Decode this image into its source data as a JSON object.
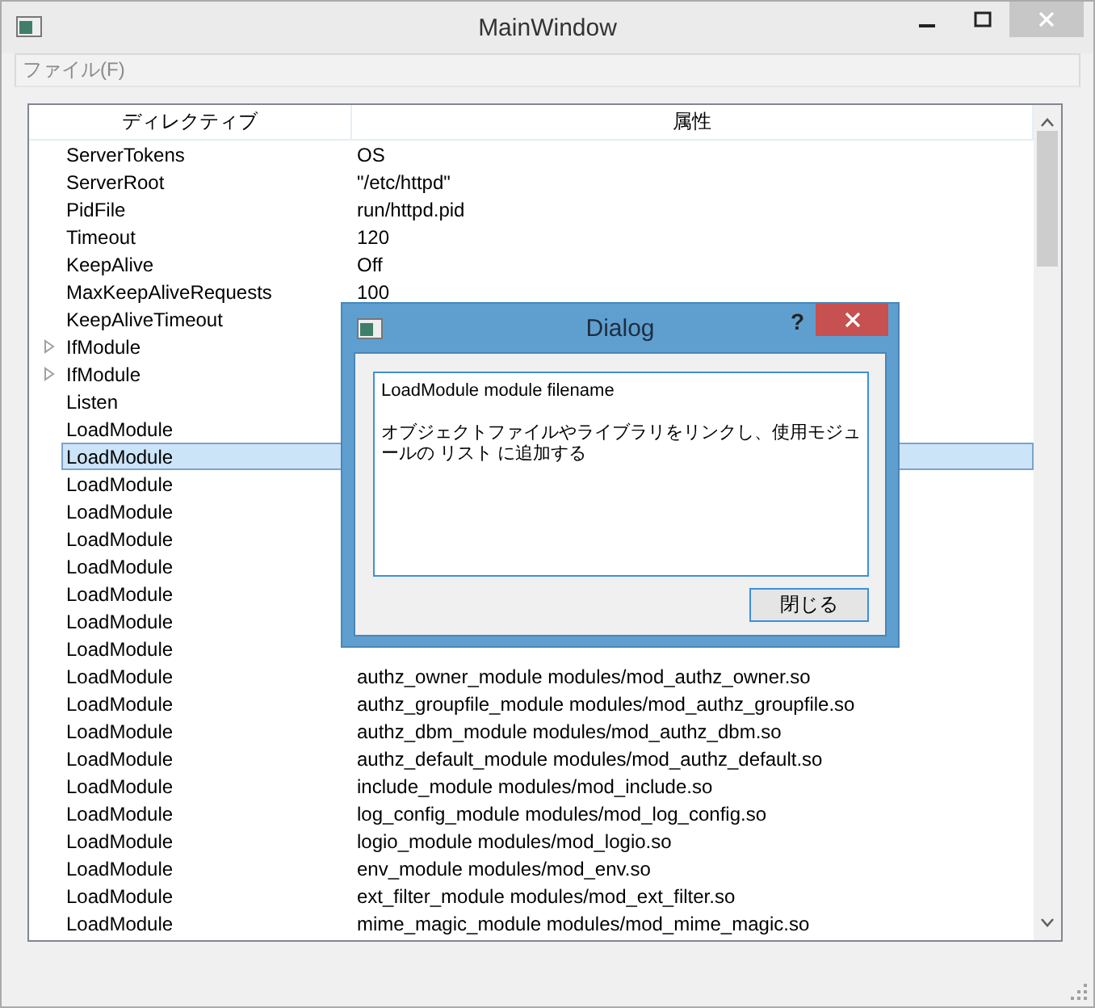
{
  "window": {
    "title": "MainWindow"
  },
  "menu": [
    {
      "label": "ファイル(F)"
    }
  ],
  "tree": {
    "columns": [
      "ディレクティブ",
      "属性"
    ],
    "rows": [
      {
        "key": "ServerTokens",
        "value": "OS",
        "expandable": false,
        "selected": false
      },
      {
        "key": "ServerRoot",
        "value": "\"/etc/httpd\"",
        "expandable": false,
        "selected": false
      },
      {
        "key": "PidFile",
        "value": "run/httpd.pid",
        "expandable": false,
        "selected": false
      },
      {
        "key": "Timeout",
        "value": "120",
        "expandable": false,
        "selected": false
      },
      {
        "key": "KeepAlive",
        "value": "Off",
        "expandable": false,
        "selected": false
      },
      {
        "key": "MaxKeepAliveRequests",
        "value": "100",
        "expandable": false,
        "selected": false
      },
      {
        "key": "KeepAliveTimeout",
        "expandable": false,
        "selected": false
      },
      {
        "key": "IfModule",
        "expandable": true,
        "selected": false
      },
      {
        "key": "IfModule",
        "expandable": true,
        "selected": false
      },
      {
        "key": "Listen",
        "expandable": false,
        "selected": false
      },
      {
        "key": "LoadModule",
        "expandable": false,
        "selected": false
      },
      {
        "key": "LoadModule",
        "expandable": false,
        "selected": true
      },
      {
        "key": "LoadModule",
        "expandable": false,
        "selected": false
      },
      {
        "key": "LoadModule",
        "expandable": false,
        "selected": false
      },
      {
        "key": "LoadModule",
        "expandable": false,
        "selected": false
      },
      {
        "key": "LoadModule",
        "expandable": false,
        "selected": false
      },
      {
        "key": "LoadModule",
        "expandable": false,
        "selected": false
      },
      {
        "key": "LoadModule",
        "expandable": false,
        "selected": false
      },
      {
        "key": "LoadModule",
        "expandable": false,
        "selected": false
      },
      {
        "key": "LoadModule",
        "value": "authz_owner_module modules/mod_authz_owner.so",
        "expandable": false,
        "selected": false
      },
      {
        "key": "LoadModule",
        "value": "authz_groupfile_module modules/mod_authz_groupfile.so",
        "expandable": false,
        "selected": false
      },
      {
        "key": "LoadModule",
        "value": "authz_dbm_module modules/mod_authz_dbm.so",
        "expandable": false,
        "selected": false
      },
      {
        "key": "LoadModule",
        "value": "authz_default_module modules/mod_authz_default.so",
        "expandable": false,
        "selected": false
      },
      {
        "key": "LoadModule",
        "value": "include_module modules/mod_include.so",
        "expandable": false,
        "selected": false
      },
      {
        "key": "LoadModule",
        "value": "log_config_module modules/mod_log_config.so",
        "expandable": false,
        "selected": false
      },
      {
        "key": "LoadModule",
        "value": "logio_module modules/mod_logio.so",
        "expandable": false,
        "selected": false
      },
      {
        "key": "LoadModule",
        "value": "env_module modules/mod_env.so",
        "expandable": false,
        "selected": false
      },
      {
        "key": "LoadModule",
        "value": "ext_filter_module modules/mod_ext_filter.so",
        "expandable": false,
        "selected": false
      },
      {
        "key": "LoadModule",
        "value": "mime_magic_module modules/mod_mime_magic.so",
        "expandable": false,
        "selected": false
      }
    ]
  },
  "dialog": {
    "title": "Dialog",
    "help": "?",
    "syntax": "LoadModule module filename",
    "description": "オブジェクトファイルやライブラリをリンクし、使用モジュールの リスト に追加する",
    "button": "閉じる"
  }
}
